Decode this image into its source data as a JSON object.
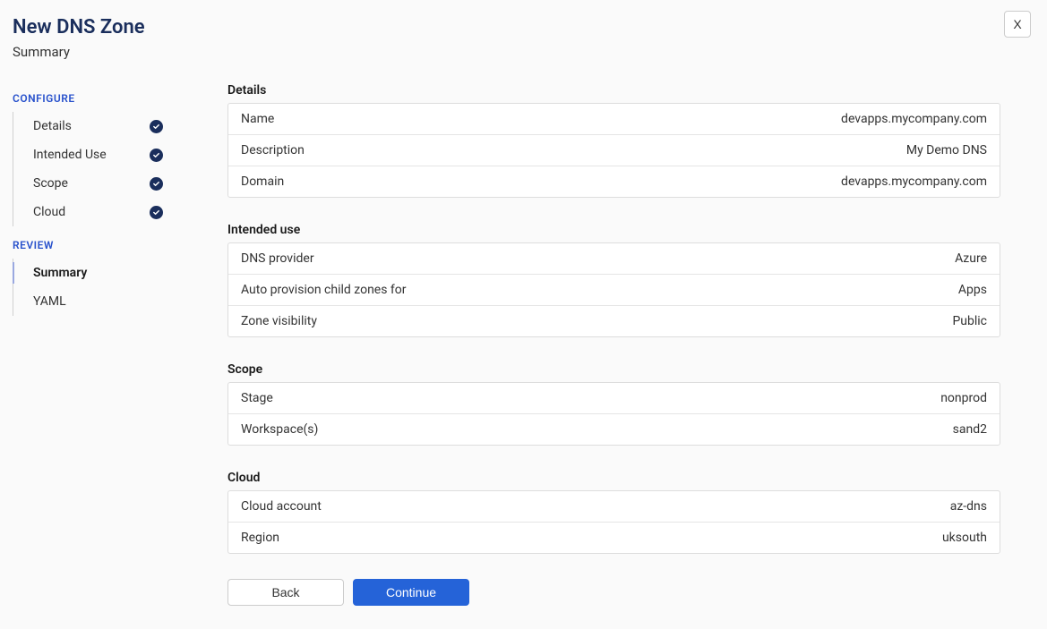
{
  "header": {
    "title": "New DNS Zone",
    "subtitle": "Summary",
    "close_label": "X"
  },
  "sidebar": {
    "configure_label": "CONFIGURE",
    "review_label": "REVIEW",
    "configure_items": [
      {
        "label": "Details",
        "completed": true
      },
      {
        "label": "Intended Use",
        "completed": true
      },
      {
        "label": "Scope",
        "completed": true
      },
      {
        "label": "Cloud",
        "completed": true
      }
    ],
    "review_items": [
      {
        "label": "Summary",
        "active": true
      },
      {
        "label": "YAML",
        "active": false
      }
    ]
  },
  "sections": {
    "details": {
      "heading": "Details",
      "rows": [
        {
          "key": "Name",
          "value": "devapps.mycompany.com"
        },
        {
          "key": "Description",
          "value": "My Demo DNS"
        },
        {
          "key": "Domain",
          "value": "devapps.mycompany.com"
        }
      ]
    },
    "intended_use": {
      "heading": "Intended use",
      "rows": [
        {
          "key": "DNS provider",
          "value": "Azure"
        },
        {
          "key": "Auto provision child zones for",
          "value": "Apps"
        },
        {
          "key": "Zone visibility",
          "value": "Public"
        }
      ]
    },
    "scope": {
      "heading": "Scope",
      "rows": [
        {
          "key": "Stage",
          "value": "nonprod"
        },
        {
          "key": "Workspace(s)",
          "value": "sand2"
        }
      ]
    },
    "cloud": {
      "heading": "Cloud",
      "rows": [
        {
          "key": "Cloud account",
          "value": "az-dns"
        },
        {
          "key": "Region",
          "value": "uksouth"
        }
      ]
    }
  },
  "actions": {
    "back_label": "Back",
    "continue_label": "Continue"
  }
}
